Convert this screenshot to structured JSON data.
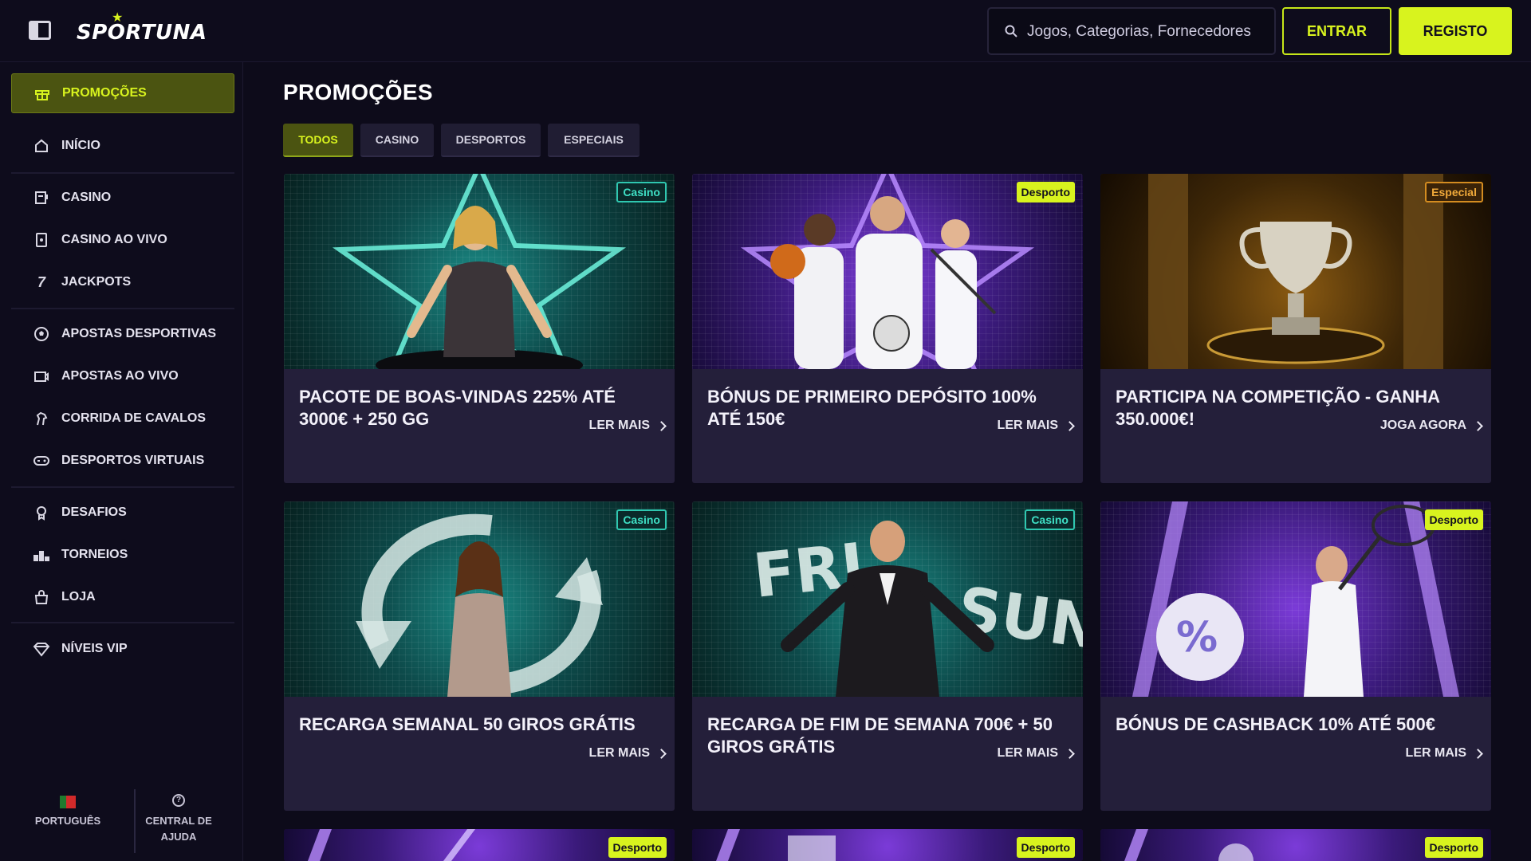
{
  "header": {
    "logo": "SPORTUNA",
    "search_placeholder": "Jogos, Categorias, Fornecedores",
    "login_label": "ENTRAR",
    "register_label": "REGISTO"
  },
  "sidebar": {
    "items": [
      {
        "label": "PROMOÇÕES",
        "icon": "gift-icon"
      },
      {
        "label": "INÍCIO",
        "icon": "home-icon"
      },
      {
        "label": "CASINO",
        "icon": "slot-machine-icon"
      },
      {
        "label": "CASINO AO VIVO",
        "icon": "live-cards-icon"
      },
      {
        "label": "JACKPOTS",
        "icon": "seven-icon"
      },
      {
        "label": "APOSTAS DESPORTIVAS",
        "icon": "football-icon"
      },
      {
        "label": "APOSTAS AO VIVO",
        "icon": "live-tv-icon"
      },
      {
        "label": "CORRIDA DE CAVALOS",
        "icon": "horse-icon"
      },
      {
        "label": "DESPORTOS VIRTUAIS",
        "icon": "gamepad-icon"
      },
      {
        "label": "DESAFIOS",
        "icon": "medal-icon"
      },
      {
        "label": "TORNEIOS",
        "icon": "podium-icon"
      },
      {
        "label": "LOJA",
        "icon": "shop-icon"
      },
      {
        "label": "NÍVEIS VIP",
        "icon": "diamond-icon"
      }
    ],
    "language_label": "PORTUGUÊS",
    "help_label_line1": "CENTRAL DE",
    "help_label_line2": "AJUDA"
  },
  "main": {
    "title": "PROMOÇÕES",
    "tabs": [
      "TODOS",
      "CASINO",
      "DESPORTOS",
      "ESPECIAIS"
    ],
    "active_tab": "TODOS",
    "cards": [
      {
        "badge": "Casino",
        "title": "PACOTE DE BOAS-VINDAS 225% ATÉ 3000€ + 250 GG",
        "cta": "LER MAIS"
      },
      {
        "badge": "Desporto",
        "title": "BÓNUS DE PRIMEIRO DEPÓSITO 100% ATÉ 150€",
        "cta": "LER MAIS"
      },
      {
        "badge": "Especial",
        "title": "PARTICIPA NA COMPETIÇÃO - GANHA 350.000€!",
        "cta": "JOGA AGORA"
      },
      {
        "badge": "Casino",
        "title": "RECARGA SEMANAL 50 GIROS GRÁTIS",
        "cta": "LER MAIS"
      },
      {
        "badge": "Casino",
        "title": "RECARGA DE FIM DE SEMANA 700€ + 50 GIROS GRÁTIS",
        "cta": "LER MAIS"
      },
      {
        "badge": "Desporto",
        "title": "BÓNUS DE CASHBACK 10% ATÉ 500€",
        "cta": "LER MAIS"
      },
      {
        "badge": "Desporto",
        "title": "",
        "cta": ""
      },
      {
        "badge": "Desporto",
        "title": "",
        "cta": ""
      },
      {
        "badge": "Desporto",
        "title": "",
        "cta": ""
      }
    ],
    "card2_image_text_left": "FRI",
    "card2_image_text_right": "SUN"
  },
  "colors": {
    "accent": "#d8f31e",
    "background": "#0d0b1a",
    "card": "#241f3a"
  }
}
